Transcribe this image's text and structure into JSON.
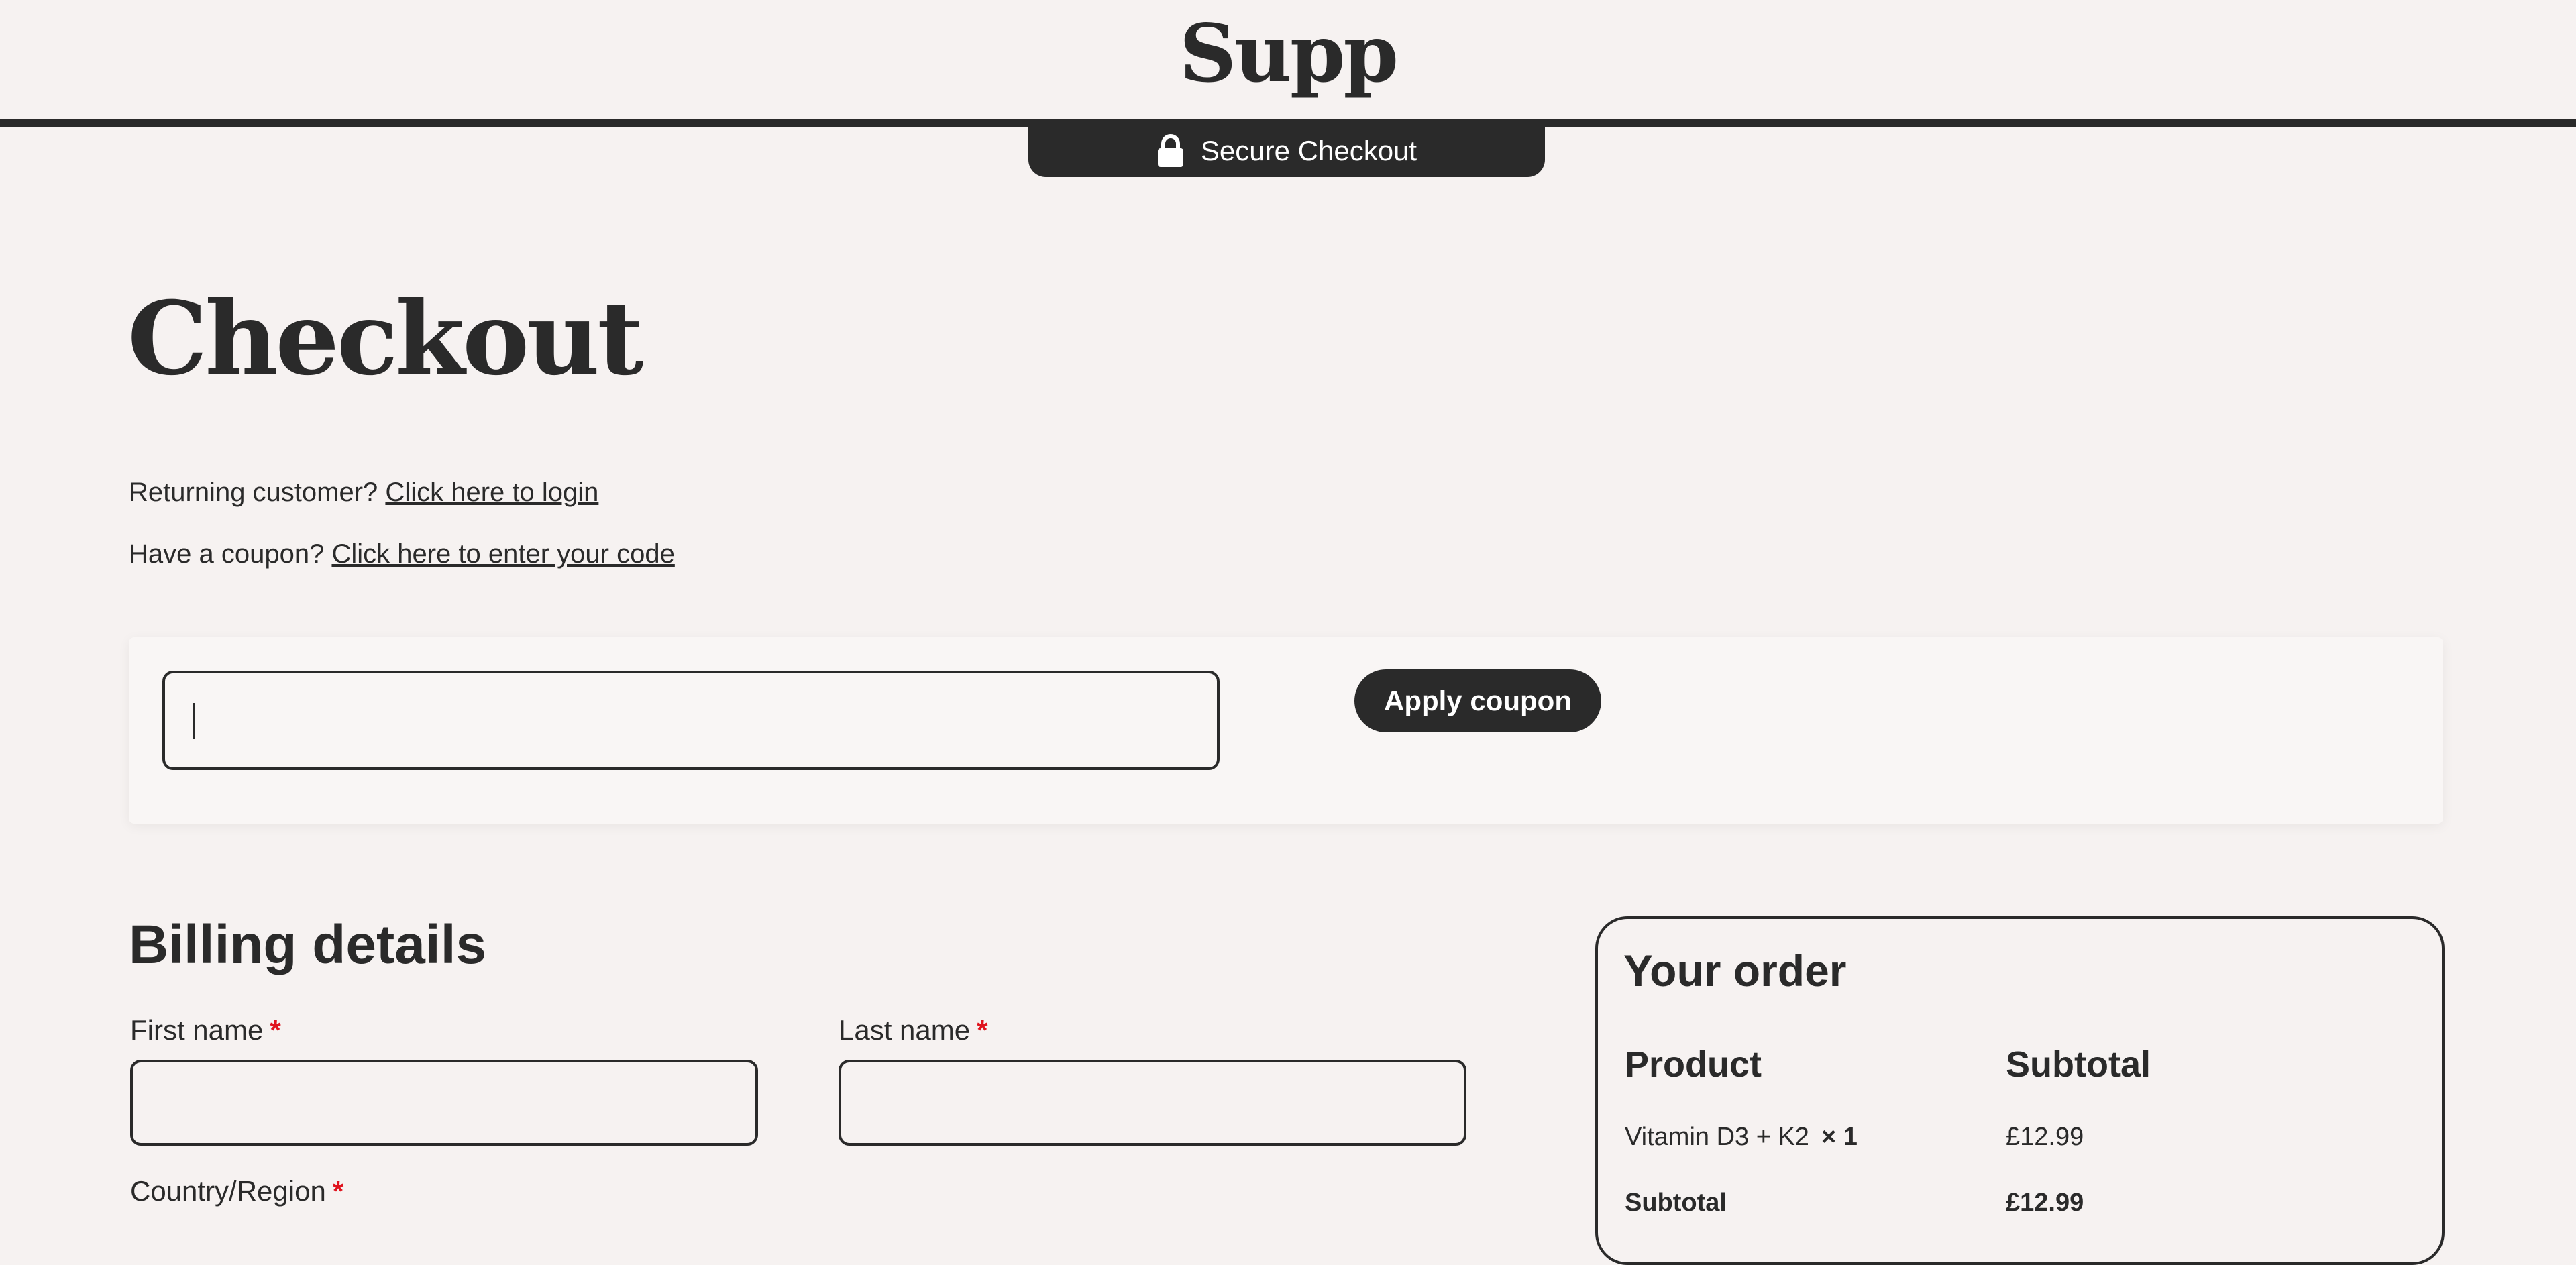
{
  "header": {
    "logo": "Supp",
    "secure_label": "Secure Checkout"
  },
  "page": {
    "title": "Checkout"
  },
  "notices": {
    "login_prefix": "Returning customer?",
    "login_link": "Click here to login",
    "coupon_prefix": "Have a coupon?",
    "coupon_link": "Click here to enter your code"
  },
  "coupon": {
    "input_value": "",
    "apply_label": "Apply coupon"
  },
  "billing": {
    "title": "Billing details",
    "first_name_label": "First name",
    "last_name_label": "Last name",
    "country_label": "Country/Region",
    "required_mark": "*"
  },
  "order": {
    "title": "Your order",
    "col_product": "Product",
    "col_subtotal": "Subtotal",
    "items": [
      {
        "name": "Vitamin D3 + K2",
        "qty": "× 1",
        "price": "£12.99"
      }
    ],
    "subtotal_label": "Subtotal",
    "subtotal_value": "£12.99"
  },
  "colors": {
    "background": "#f6f2f1",
    "dark": "#2a2a2a",
    "required": "#e0141e"
  },
  "icons": {
    "secure": "lock-icon"
  }
}
